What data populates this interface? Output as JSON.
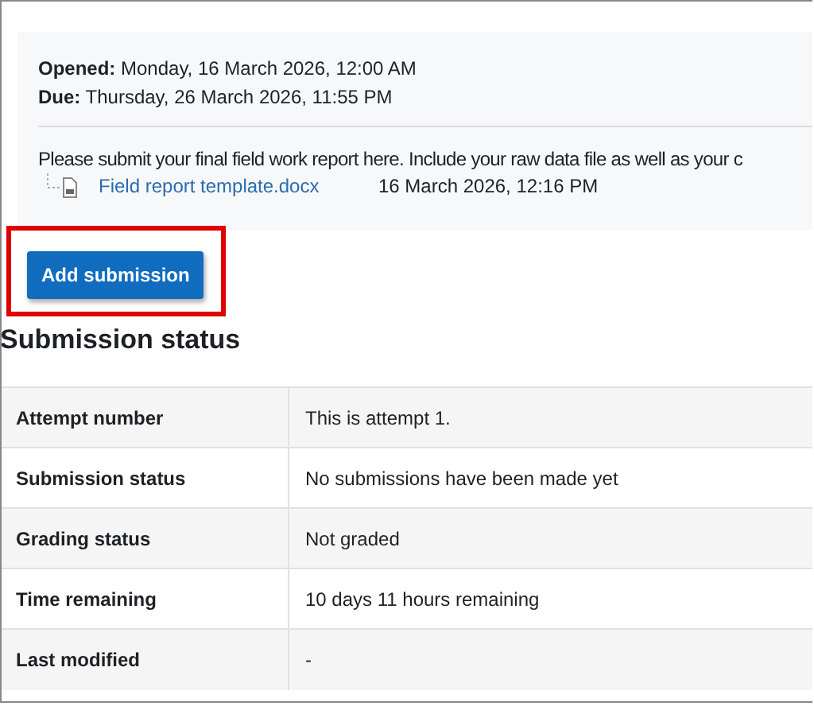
{
  "dates": [
    {
      "label": "Opened:",
      "value": "Monday, 16 March 2026, 12:00 AM"
    },
    {
      "label": "Due:",
      "value": "Thursday, 26 March 2026, 11:55 PM"
    }
  ],
  "description": "Please submit your final field work report here. Include your raw data file as well as your c",
  "attachment": {
    "name": "Field report template.docx",
    "date": "16 March 2026, 12:16 PM"
  },
  "add_button": {
    "label": "Add submission",
    "highlighted": true
  },
  "heading": "Submission status",
  "rows": [
    {
      "label": "Attempt number",
      "value": "This is attempt 1."
    },
    {
      "label": "Submission status",
      "value": "No submissions have been made yet"
    },
    {
      "label": "Grading status",
      "value": "Not graded"
    },
    {
      "label": "Time remaining",
      "value": "10 days 11 hours remaining"
    },
    {
      "label": "Last modified",
      "value": "-"
    }
  ]
}
